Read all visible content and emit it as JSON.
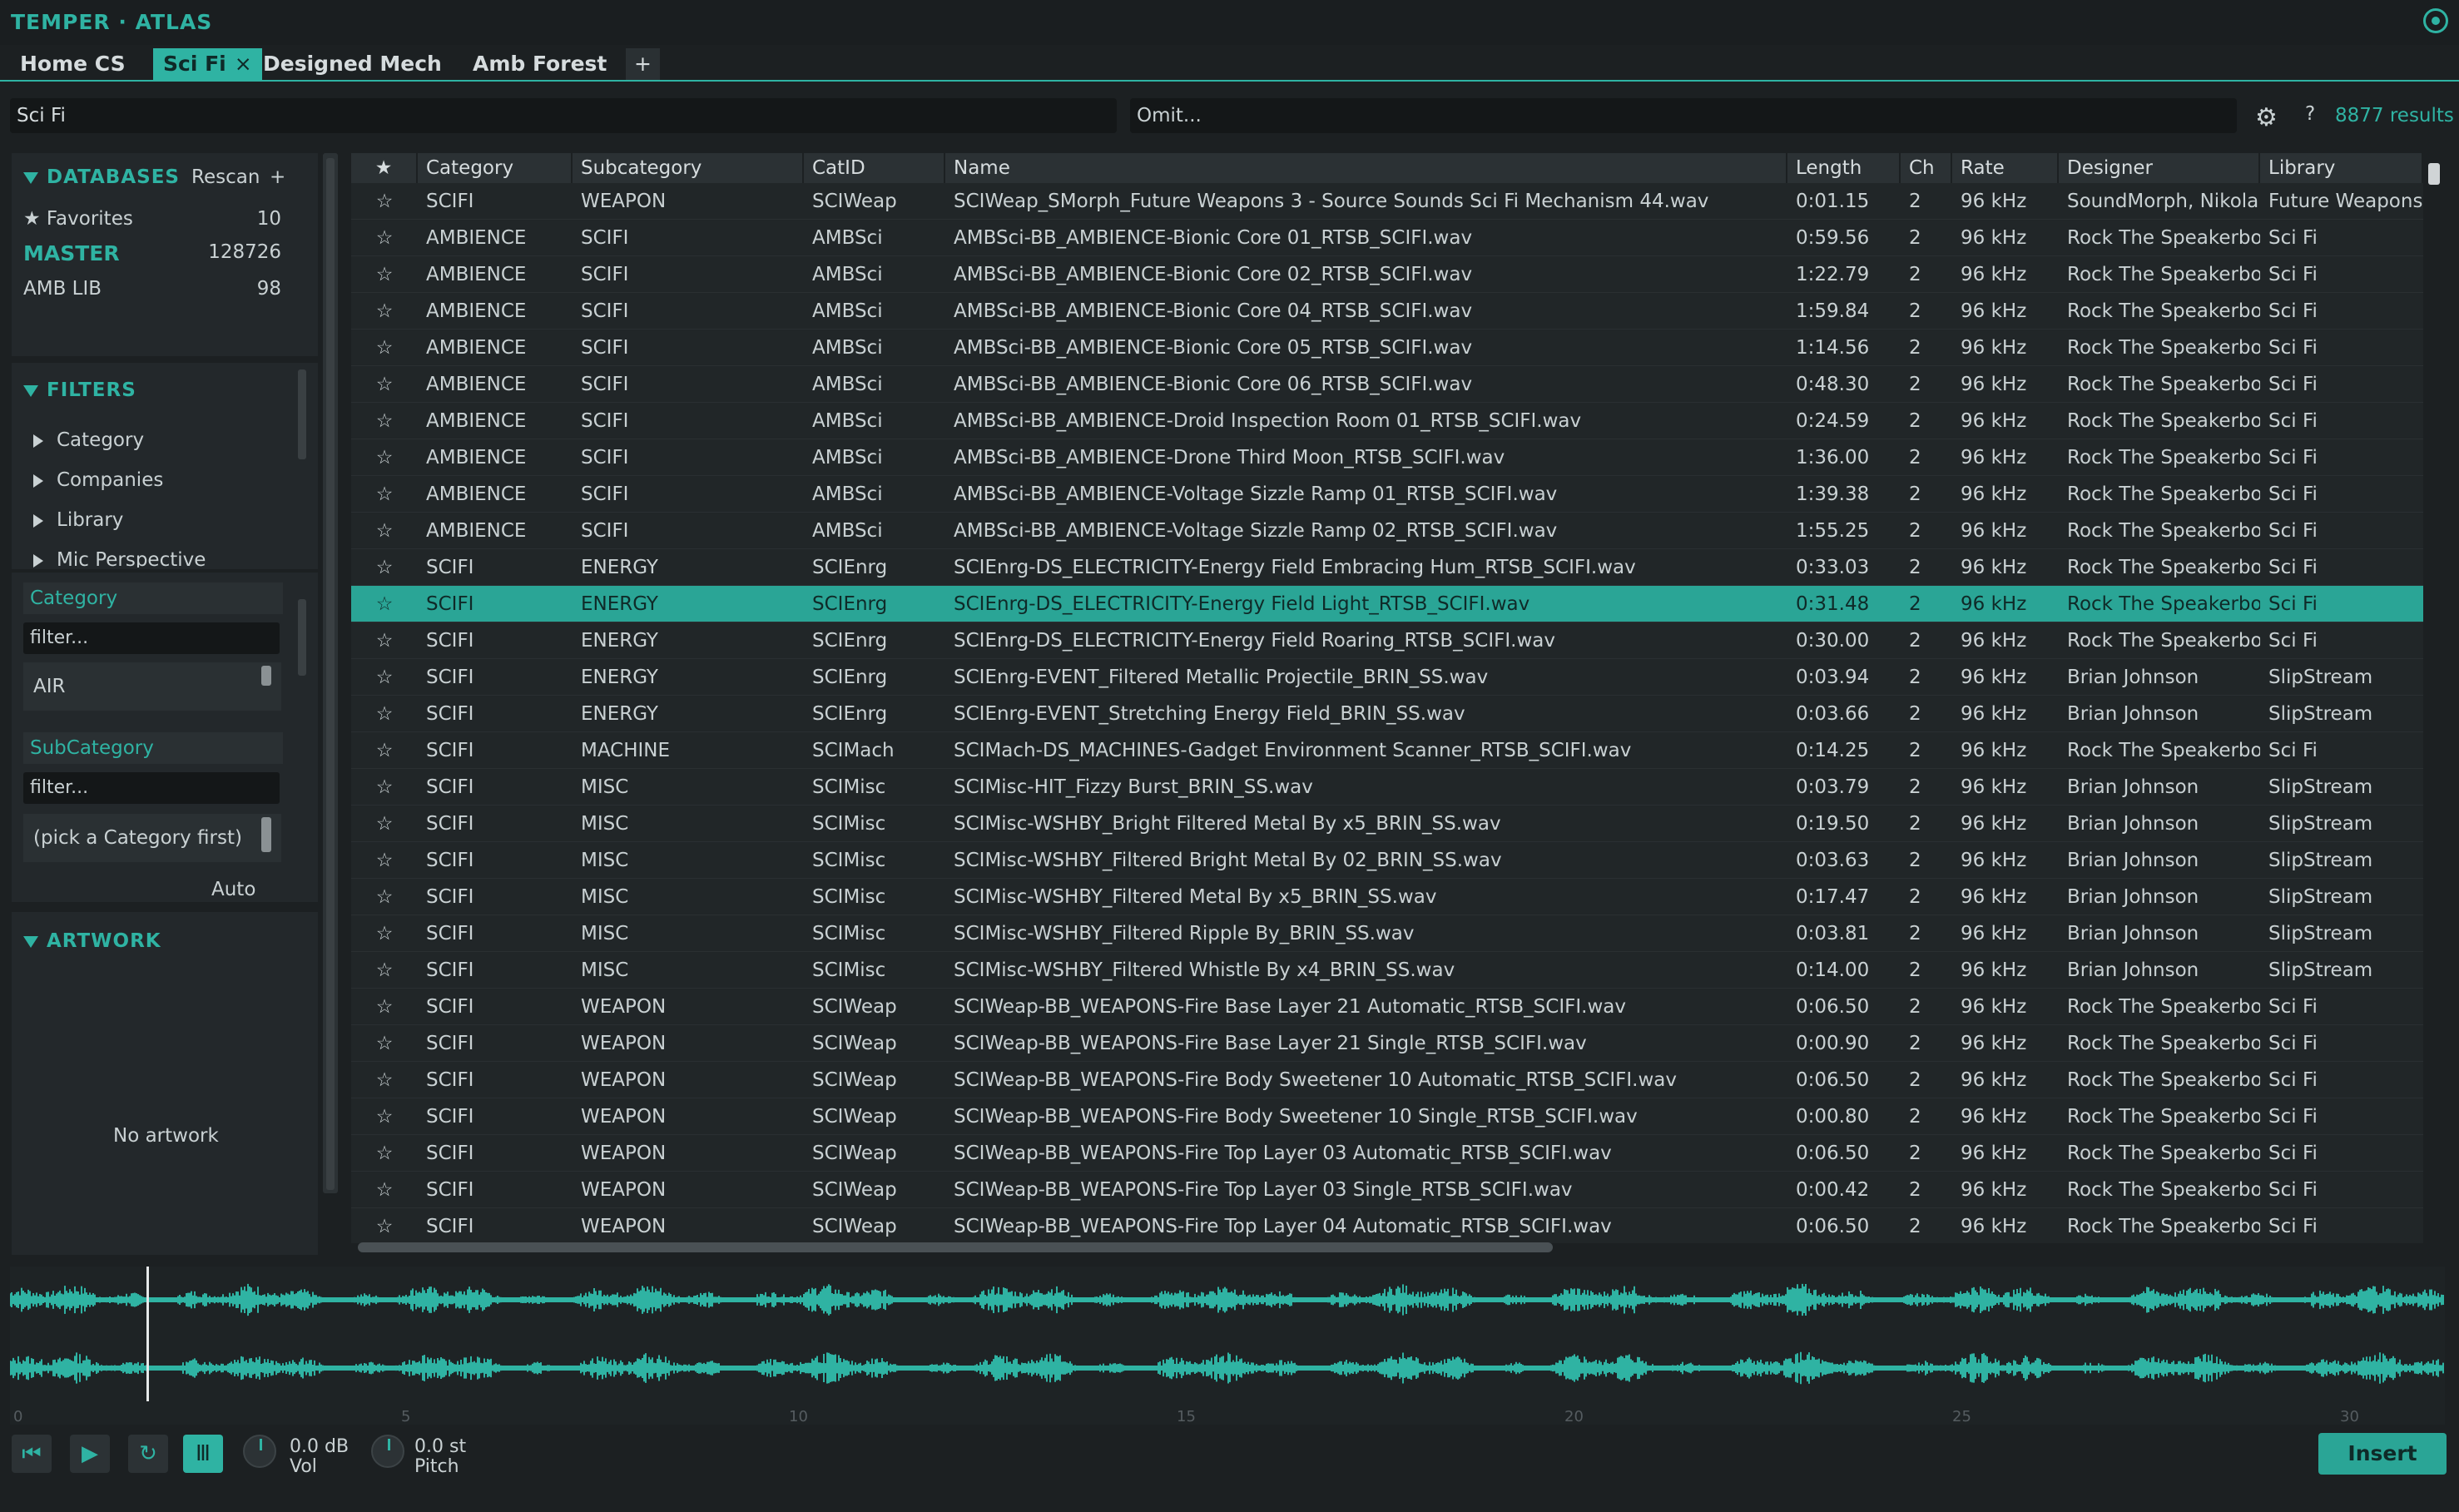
{
  "app": {
    "title": "TEMPER · ATLAS"
  },
  "tabs": [
    {
      "label": "Home CS"
    },
    {
      "label": "Sci Fi",
      "close": "×"
    },
    {
      "label": "Designed Mech"
    },
    {
      "label": "Amb Forest"
    },
    {
      "label": "+"
    }
  ],
  "search": {
    "query": "Sci Fi",
    "omit_placeholder": "Omit...",
    "help": "?",
    "results": "8877 results"
  },
  "databases": {
    "title": "DATABASES",
    "rescan_label": "Rescan",
    "add_label": "+",
    "items": [
      {
        "label": "★ Favorites",
        "count": "10"
      },
      {
        "label": "MASTER",
        "count": "128726"
      },
      {
        "label": "AMB LIB",
        "count": "98"
      }
    ]
  },
  "filters": {
    "title": "FILTERS",
    "items": [
      "Category",
      "Companies",
      "Library",
      "Mic Perspective"
    ],
    "category_label": "Category",
    "category_filter_placeholder": "filter...",
    "category_value": "AIR",
    "subcategory_label": "SubCategory",
    "subcategory_filter_placeholder": "filter...",
    "subcategory_value": "(pick a Category first)",
    "auto_label": "Auto"
  },
  "artwork": {
    "title": "ARTWORK",
    "empty": "No artwork"
  },
  "table": {
    "columns": [
      "★",
      "Category",
      "Subcategory",
      "CatID",
      "Name",
      "Length",
      "Ch",
      "Rate",
      "Designer",
      "Library"
    ],
    "selected_index": 11,
    "rows": [
      [
        "☆",
        "SCIFI",
        "WEAPON",
        "SCIWeap",
        "SCIWeap_SMorph_Future Weapons 3 - Source Sounds Sci Fi Mechanism 44.wav",
        "0:01.15",
        "2",
        "96 kHz",
        "SoundMorph, Nikola",
        "Future Weapons"
      ],
      [
        "☆",
        "AMBIENCE",
        "SCIFI",
        "AMBSci",
        "AMBSci-BB_AMBIENCE-Bionic Core 01_RTSB_SCIFI.wav",
        "0:59.56",
        "2",
        "96 kHz",
        "Rock The Speakerbo",
        "Sci Fi"
      ],
      [
        "☆",
        "AMBIENCE",
        "SCIFI",
        "AMBSci",
        "AMBSci-BB_AMBIENCE-Bionic Core 02_RTSB_SCIFI.wav",
        "1:22.79",
        "2",
        "96 kHz",
        "Rock The Speakerbo",
        "Sci Fi"
      ],
      [
        "☆",
        "AMBIENCE",
        "SCIFI",
        "AMBSci",
        "AMBSci-BB_AMBIENCE-Bionic Core 04_RTSB_SCIFI.wav",
        "1:59.84",
        "2",
        "96 kHz",
        "Rock The Speakerbo",
        "Sci Fi"
      ],
      [
        "☆",
        "AMBIENCE",
        "SCIFI",
        "AMBSci",
        "AMBSci-BB_AMBIENCE-Bionic Core 05_RTSB_SCIFI.wav",
        "1:14.56",
        "2",
        "96 kHz",
        "Rock The Speakerbo",
        "Sci Fi"
      ],
      [
        "☆",
        "AMBIENCE",
        "SCIFI",
        "AMBSci",
        "AMBSci-BB_AMBIENCE-Bionic Core 06_RTSB_SCIFI.wav",
        "0:48.30",
        "2",
        "96 kHz",
        "Rock The Speakerbo",
        "Sci Fi"
      ],
      [
        "☆",
        "AMBIENCE",
        "SCIFI",
        "AMBSci",
        "AMBSci-BB_AMBIENCE-Droid Inspection Room 01_RTSB_SCIFI.wav",
        "0:24.59",
        "2",
        "96 kHz",
        "Rock The Speakerbo",
        "Sci Fi"
      ],
      [
        "☆",
        "AMBIENCE",
        "SCIFI",
        "AMBSci",
        "AMBSci-BB_AMBIENCE-Drone Third Moon_RTSB_SCIFI.wav",
        "1:36.00",
        "2",
        "96 kHz",
        "Rock The Speakerbo",
        "Sci Fi"
      ],
      [
        "☆",
        "AMBIENCE",
        "SCIFI",
        "AMBSci",
        "AMBSci-BB_AMBIENCE-Voltage Sizzle Ramp 01_RTSB_SCIFI.wav",
        "1:39.38",
        "2",
        "96 kHz",
        "Rock The Speakerbo",
        "Sci Fi"
      ],
      [
        "☆",
        "AMBIENCE",
        "SCIFI",
        "AMBSci",
        "AMBSci-BB_AMBIENCE-Voltage Sizzle Ramp 02_RTSB_SCIFI.wav",
        "1:55.25",
        "2",
        "96 kHz",
        "Rock The Speakerbo",
        "Sci Fi"
      ],
      [
        "☆",
        "SCIFI",
        "ENERGY",
        "SCIEnrg",
        "SCIEnrg-DS_ELECTRICITY-Energy Field Embracing Hum_RTSB_SCIFI.wav",
        "0:33.03",
        "2",
        "96 kHz",
        "Rock The Speakerbo",
        "Sci Fi"
      ],
      [
        "☆",
        "SCIFI",
        "ENERGY",
        "SCIEnrg",
        "SCIEnrg-DS_ELECTRICITY-Energy Field Light_RTSB_SCIFI.wav",
        "0:31.48",
        "2",
        "96 kHz",
        "Rock The Speakerbo",
        "Sci Fi"
      ],
      [
        "☆",
        "SCIFI",
        "ENERGY",
        "SCIEnrg",
        "SCIEnrg-DS_ELECTRICITY-Energy Field Roaring_RTSB_SCIFI.wav",
        "0:30.00",
        "2",
        "96 kHz",
        "Rock The Speakerbo",
        "Sci Fi"
      ],
      [
        "☆",
        "SCIFI",
        "ENERGY",
        "SCIEnrg",
        "SCIEnrg-EVENT_Filtered Metallic Projectile_BRIN_SS.wav",
        "0:03.94",
        "2",
        "96 kHz",
        "Brian Johnson",
        "SlipStream"
      ],
      [
        "☆",
        "SCIFI",
        "ENERGY",
        "SCIEnrg",
        "SCIEnrg-EVENT_Stretching Energy Field_BRIN_SS.wav",
        "0:03.66",
        "2",
        "96 kHz",
        "Brian Johnson",
        "SlipStream"
      ],
      [
        "☆",
        "SCIFI",
        "MACHINE",
        "SCIMach",
        "SCIMach-DS_MACHINES-Gadget Environment Scanner_RTSB_SCIFI.wav",
        "0:14.25",
        "2",
        "96 kHz",
        "Rock The Speakerbo",
        "Sci Fi"
      ],
      [
        "☆",
        "SCIFI",
        "MISC",
        "SCIMisc",
        "SCIMisc-HIT_Fizzy Burst_BRIN_SS.wav",
        "0:03.79",
        "2",
        "96 kHz",
        "Brian Johnson",
        "SlipStream"
      ],
      [
        "☆",
        "SCIFI",
        "MISC",
        "SCIMisc",
        "SCIMisc-WSHBY_Bright Filtered Metal By x5_BRIN_SS.wav",
        "0:19.50",
        "2",
        "96 kHz",
        "Brian Johnson",
        "SlipStream"
      ],
      [
        "☆",
        "SCIFI",
        "MISC",
        "SCIMisc",
        "SCIMisc-WSHBY_Filtered Bright Metal By 02_BRIN_SS.wav",
        "0:03.63",
        "2",
        "96 kHz",
        "Brian Johnson",
        "SlipStream"
      ],
      [
        "☆",
        "SCIFI",
        "MISC",
        "SCIMisc",
        "SCIMisc-WSHBY_Filtered Metal By x5_BRIN_SS.wav",
        "0:17.47",
        "2",
        "96 kHz",
        "Brian Johnson",
        "SlipStream"
      ],
      [
        "☆",
        "SCIFI",
        "MISC",
        "SCIMisc",
        "SCIMisc-WSHBY_Filtered Ripple By_BRIN_SS.wav",
        "0:03.81",
        "2",
        "96 kHz",
        "Brian Johnson",
        "SlipStream"
      ],
      [
        "☆",
        "SCIFI",
        "MISC",
        "SCIMisc",
        "SCIMisc-WSHBY_Filtered Whistle By x4_BRIN_SS.wav",
        "0:14.00",
        "2",
        "96 kHz",
        "Brian Johnson",
        "SlipStream"
      ],
      [
        "☆",
        "SCIFI",
        "WEAPON",
        "SCIWeap",
        "SCIWeap-BB_WEAPONS-Fire Base Layer 21 Automatic_RTSB_SCIFI.wav",
        "0:06.50",
        "2",
        "96 kHz",
        "Rock The Speakerbo",
        "Sci Fi"
      ],
      [
        "☆",
        "SCIFI",
        "WEAPON",
        "SCIWeap",
        "SCIWeap-BB_WEAPONS-Fire Base Layer 21 Single_RTSB_SCIFI.wav",
        "0:00.90",
        "2",
        "96 kHz",
        "Rock The Speakerbo",
        "Sci Fi"
      ],
      [
        "☆",
        "SCIFI",
        "WEAPON",
        "SCIWeap",
        "SCIWeap-BB_WEAPONS-Fire Body Sweetener 10 Automatic_RTSB_SCIFI.wav",
        "0:06.50",
        "2",
        "96 kHz",
        "Rock The Speakerbo",
        "Sci Fi"
      ],
      [
        "☆",
        "SCIFI",
        "WEAPON",
        "SCIWeap",
        "SCIWeap-BB_WEAPONS-Fire Body Sweetener 10 Single_RTSB_SCIFI.wav",
        "0:00.80",
        "2",
        "96 kHz",
        "Rock The Speakerbo",
        "Sci Fi"
      ],
      [
        "☆",
        "SCIFI",
        "WEAPON",
        "SCIWeap",
        "SCIWeap-BB_WEAPONS-Fire Top Layer 03 Automatic_RTSB_SCIFI.wav",
        "0:06.50",
        "2",
        "96 kHz",
        "Rock The Speakerbo",
        "Sci Fi"
      ],
      [
        "☆",
        "SCIFI",
        "WEAPON",
        "SCIWeap",
        "SCIWeap-BB_WEAPONS-Fire Top Layer 03 Single_RTSB_SCIFI.wav",
        "0:00.42",
        "2",
        "96 kHz",
        "Rock The Speakerbo",
        "Sci Fi"
      ],
      [
        "☆",
        "SCIFI",
        "WEAPON",
        "SCIWeap",
        "SCIWeap-BB_WEAPONS-Fire Top Layer 04 Automatic_RTSB_SCIFI.wav",
        "0:06.50",
        "2",
        "96 kHz",
        "Rock The Speakerbo",
        "Sci Fi"
      ]
    ]
  },
  "waveform": {
    "ticks": [
      "0",
      "5",
      "10",
      "15",
      "20",
      "25",
      "30"
    ],
    "color": "#2fb3a3"
  },
  "transport": {
    "vol_value": "0.0 dB",
    "vol_label": "Vol",
    "pitch_value": "0.0 st",
    "pitch_label": "Pitch",
    "insert_label": "Insert"
  },
  "colors": {
    "accent": "#2fb3a3",
    "background": "#1c2022",
    "selected_row": "#2aa596"
  }
}
